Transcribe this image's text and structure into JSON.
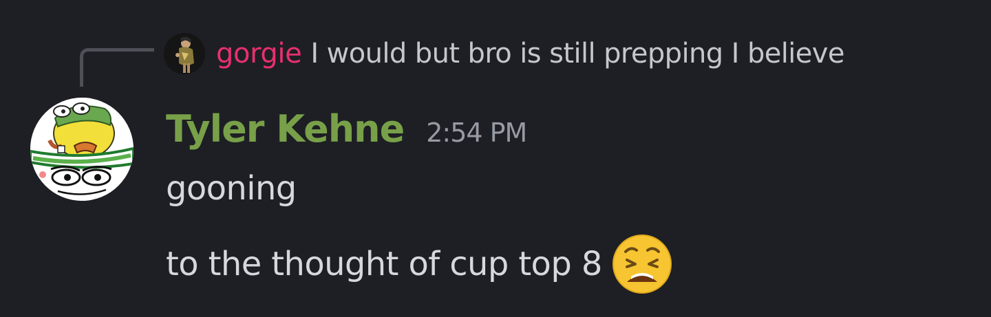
{
  "reply": {
    "author": "gorgie",
    "text": "I would but bro is still prepping I believe"
  },
  "message": {
    "author": "Tyler Kehne",
    "timestamp": "2:54 PM",
    "lines": [
      "gooning",
      "to the thought of cup top 8"
    ],
    "emoji": "weary-face-icon"
  },
  "colors": {
    "background": "#1e1f24",
    "reply_author": "#e8306e",
    "author": "#78a049",
    "timestamp": "#969aa3",
    "text": "#d6d8dd"
  }
}
